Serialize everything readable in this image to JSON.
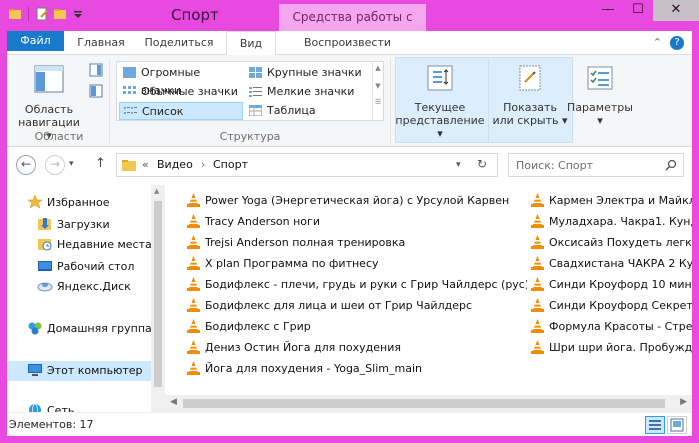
{
  "title": "Спорт",
  "context_tab_title": "Средства работы с видео",
  "window_buttons": {
    "minimize": "—",
    "maximize": "☐",
    "close": "✕"
  },
  "tabs": [
    "Файл",
    "Главная",
    "Поделиться",
    "Вид",
    "Воспроизвести"
  ],
  "ribbon": {
    "nav_area": {
      "label": "Область навигации",
      "line1": "Область",
      "line2": "навигации"
    },
    "group_panes": "Области",
    "layout_options": [
      {
        "label": "Огромные значки"
      },
      {
        "label": "Крупные значки"
      },
      {
        "label": "Обычные значки"
      },
      {
        "label": "Мелкие значки"
      },
      {
        "label": "Список"
      },
      {
        "label": "Таблица"
      }
    ],
    "group_layout": "Структура",
    "current_view": {
      "line1": "Текущее",
      "line2": "представление"
    },
    "show_hide": {
      "line1": "Показать",
      "line2": "или скрыть"
    },
    "options": "Параметры"
  },
  "address": {
    "chevrons": "«",
    "crumbs": [
      "Видео",
      "Спорт"
    ],
    "search_placeholder": "Поиск: Спорт"
  },
  "nav_pane": [
    {
      "label": "Избранное",
      "icon": "star-icon"
    },
    {
      "label": "Загрузки",
      "icon": "downloads-icon"
    },
    {
      "label": "Недавние места",
      "icon": "recent-places-icon"
    },
    {
      "label": "Рабочий стол",
      "icon": "desktop-icon"
    },
    {
      "label": "Яндекс.Диск",
      "icon": "yandex-disk-icon"
    },
    {
      "label": "Домашняя группа",
      "icon": "homegroup-icon"
    },
    {
      "label": "Этот компьютер",
      "icon": "computer-icon"
    },
    {
      "label": "Сеть",
      "icon": "network-icon"
    }
  ],
  "files_col1": [
    "Power Yoga (Энергетическая йога) с Урсулой Карвен",
    "Tracy Anderson ноги",
    "Trejsi Anderson полная тренировка",
    "X plan Программа по фитнесу",
    "Бодифлекс - плечи, грудь и руки с Грир Чайлдерс (рус)",
    "Бодифлекс для лица и шеи от Грир Чайлдерс",
    "Бодифлекс с Грир",
    "Дениз Остин Йога для похудения",
    "Йога для похудения - Yoga_Slim_main"
  ],
  "files_col2": [
    "Кармен Электра и Майкл",
    "Муладхара. Чакра1. Кунда",
    "Оксисайз Похудеть легко!",
    "Свадхистана ЧАКРА 2 Кун",
    "Синди Кроуфорд 10 минут",
    "Синди Кроуфорд Секрет и",
    "Формула Красоты - Стрет",
    "Шри шри йога. Пробужде"
  ],
  "status": {
    "items_count": "Элементов: 17"
  },
  "colors": {
    "accent": "#1979ca",
    "frame": "#e84ae0",
    "selection": "#cce8ff"
  }
}
